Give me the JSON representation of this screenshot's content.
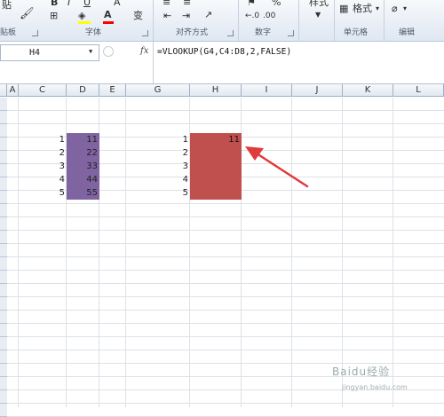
{
  "ribbon": {
    "paste_label": "贴",
    "bold": "B",
    "italic": "I",
    "underline": "U",
    "font_increase": "A",
    "wen": "变",
    "percent": "%",
    "style_label": "样式",
    "format_label": "格式",
    "groups": {
      "clipboard": "贴板",
      "font": "字体",
      "alignment": "对齐方式",
      "number": "数字",
      "cells": "单元格",
      "editing": "编辑"
    }
  },
  "formula_bar": {
    "name_box": "H4",
    "fx": "fx",
    "formula": "=VLOOKUP(G4,C4:D8,2,FALSE)"
  },
  "columns": [
    "A",
    "C",
    "D",
    "E",
    "G",
    "H",
    "I",
    "J",
    "K",
    "L"
  ],
  "table1": {
    "keys": [
      "1",
      "2",
      "3",
      "4",
      "5"
    ],
    "values": [
      "11",
      "22",
      "33",
      "44",
      "55"
    ]
  },
  "table2": {
    "keys": [
      "1",
      "2",
      "3",
      "4",
      "5"
    ],
    "result": "11"
  },
  "colors": {
    "purple": "#8064a2",
    "red": "#c0504d",
    "arrow": "#e03a3a"
  },
  "watermark": {
    "brand": "Baidu经验",
    "url": "jingyan.baidu.com"
  }
}
